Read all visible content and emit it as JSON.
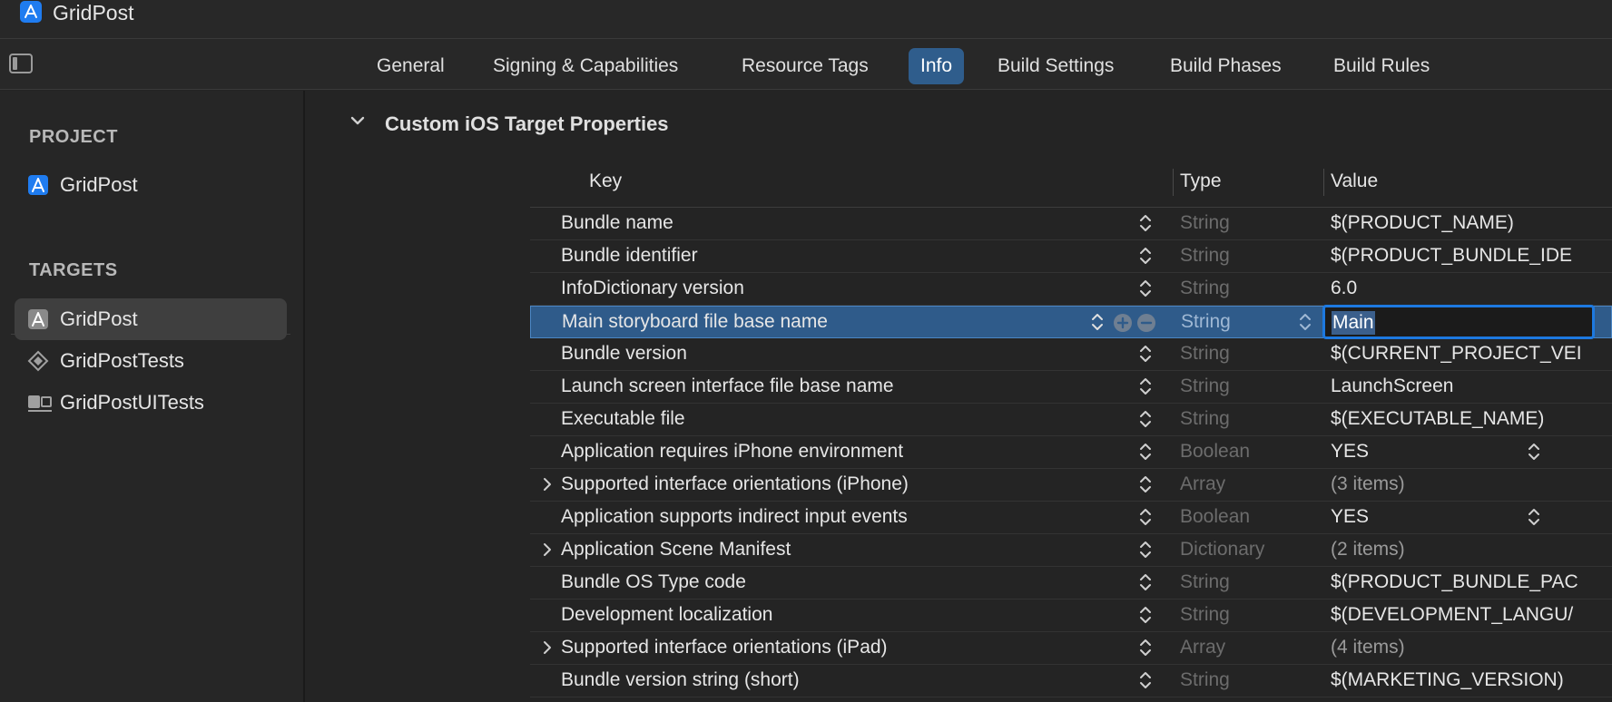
{
  "window": {
    "title": "GridPost"
  },
  "tabs": [
    {
      "label": "General",
      "active": false
    },
    {
      "label": "Signing & Capabilities",
      "active": false
    },
    {
      "label": "Resource Tags",
      "active": false
    },
    {
      "label": "Info",
      "active": true
    },
    {
      "label": "Build Settings",
      "active": false
    },
    {
      "label": "Build Phases",
      "active": false
    },
    {
      "label": "Build Rules",
      "active": false
    }
  ],
  "sidebar": {
    "project_header": "PROJECT",
    "project_item": "GridPost",
    "targets_header": "TARGETS",
    "targets": [
      {
        "label": "GridPost",
        "icon": "app-target-icon",
        "selected": true
      },
      {
        "label": "GridPostTests",
        "icon": "unit-test-icon",
        "selected": false
      },
      {
        "label": "GridPostUITests",
        "icon": "ui-test-icon",
        "selected": false
      }
    ]
  },
  "main": {
    "section_title": "Custom iOS Target Properties",
    "columns": {
      "key": "Key",
      "type": "Type",
      "value": "Value"
    },
    "rows": [
      {
        "key": "Bundle name",
        "type": "String",
        "value": "$(PRODUCT_NAME)"
      },
      {
        "key": "Bundle identifier",
        "type": "String",
        "value": "$(PRODUCT_BUNDLE_IDE"
      },
      {
        "key": "InfoDictionary version",
        "type": "String",
        "value": "6.0"
      },
      {
        "key": "Main storyboard file base name",
        "type": "String",
        "value": "Main",
        "selected": true
      },
      {
        "key": "Bundle version",
        "type": "String",
        "value": "$(CURRENT_PROJECT_VEI"
      },
      {
        "key": "Launch screen interface file base name",
        "type": "String",
        "value": "LaunchScreen"
      },
      {
        "key": "Executable file",
        "type": "String",
        "value": "$(EXECUTABLE_NAME)"
      },
      {
        "key": "Application requires iPhone environment",
        "type": "Boolean",
        "value": "YES"
      },
      {
        "key": "Supported interface orientations (iPhone)",
        "type": "Array",
        "value": "(3 items)"
      },
      {
        "key": "Application supports indirect input events",
        "type": "Boolean",
        "value": "YES"
      },
      {
        "key": "Application Scene Manifest",
        "type": "Dictionary",
        "value": "(2 items)"
      },
      {
        "key": "Bundle OS Type code",
        "type": "String",
        "value": "$(PRODUCT_BUNDLE_PAC"
      },
      {
        "key": "Development localization",
        "type": "String",
        "value": "$(DEVELOPMENT_LANGU/"
      },
      {
        "key": "Supported interface orientations (iPad)",
        "type": "Array",
        "value": "(4 items)"
      },
      {
        "key": "Bundle version string (short)",
        "type": "String",
        "value": "$(MARKETING_VERSION)"
      }
    ]
  },
  "colors": {
    "accent": "#1d79e0",
    "selected_row": "#2f5b8a",
    "active_tab": "#2f5d8c",
    "background": "#242424"
  }
}
